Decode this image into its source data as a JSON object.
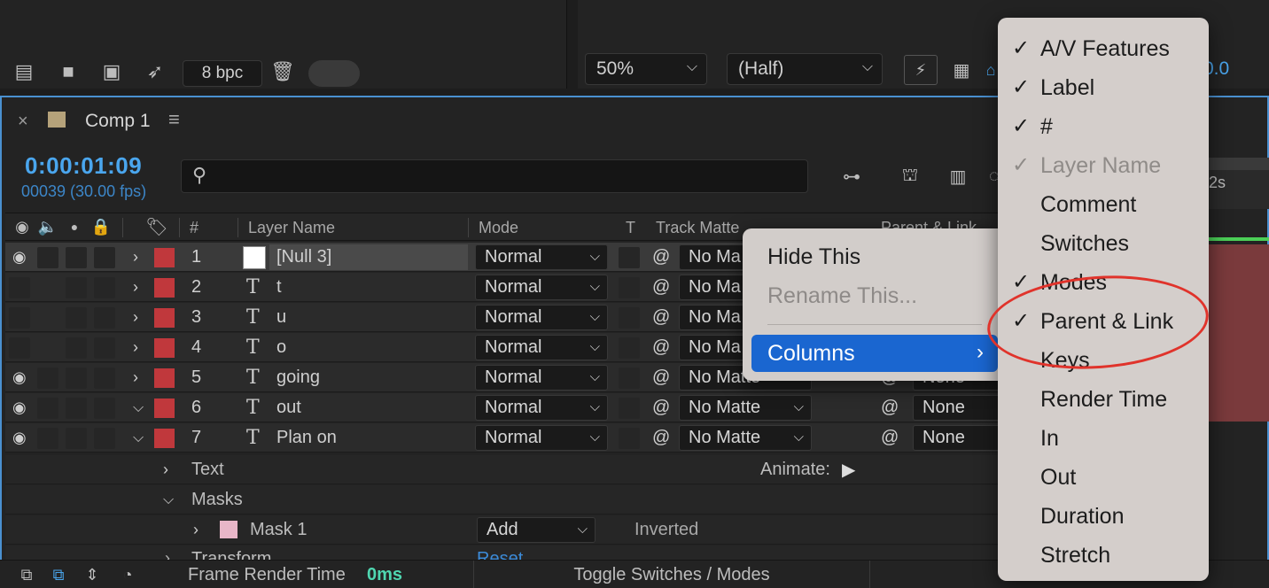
{
  "project_toolbar": {
    "bpc": "8 bpc"
  },
  "viewer_toolbar": {
    "zoom": "50%",
    "resolution": "(Half)",
    "exposure_value": "0.0"
  },
  "timeline": {
    "tab_title": "Comp 1",
    "timecode": "0:00:01:09",
    "frame_info": "00039 (30.00 fps)",
    "ruler_label": "2s",
    "columns": {
      "number": "#",
      "layer_name": "Layer Name",
      "mode": "Mode",
      "t": "T",
      "track_matte": "Track Matte",
      "parent_link": "Parent & Link"
    },
    "layers": [
      {
        "num": "1",
        "name": "[Null 3]",
        "mode": "Normal",
        "matte": "No Ma",
        "parent": "",
        "visible": true,
        "expanded": false
      },
      {
        "num": "2",
        "name": "t",
        "mode": "Normal",
        "matte": "No Ma",
        "parent": "",
        "visible": false,
        "expanded": false
      },
      {
        "num": "3",
        "name": "u",
        "mode": "Normal",
        "matte": "No Ma",
        "parent": "",
        "visible": false,
        "expanded": false
      },
      {
        "num": "4",
        "name": "o",
        "mode": "Normal",
        "matte": "No Ma",
        "parent": "",
        "visible": false,
        "expanded": false
      },
      {
        "num": "5",
        "name": "going",
        "mode": "Normal",
        "matte": "No Matte",
        "parent": "None",
        "visible": true,
        "expanded": false
      },
      {
        "num": "6",
        "name": "out",
        "mode": "Normal",
        "matte": "No Matte",
        "parent": "None",
        "visible": true,
        "expanded": true
      },
      {
        "num": "7",
        "name": "Plan on",
        "mode": "Normal",
        "matte": "No Matte",
        "parent": "None",
        "visible": true,
        "expanded": true
      }
    ],
    "sub_rows": {
      "text": "Text",
      "animate": "Animate:",
      "masks": "Masks",
      "mask1": "Mask 1",
      "mask_mode": "Add",
      "inverted": "Inverted",
      "transform": "Transform",
      "reset": "Reset"
    },
    "footer": {
      "frame_render_label": "Frame Render Time",
      "frame_render_value": "0ms",
      "toggle": "Toggle Switches / Modes"
    }
  },
  "context_menu": {
    "hide_this": "Hide This",
    "rename_this": "Rename This...",
    "columns": "Columns"
  },
  "columns_submenu": [
    {
      "label": "A/V Features",
      "checked": true,
      "disabled": false
    },
    {
      "label": "Label",
      "checked": true,
      "disabled": false
    },
    {
      "label": "#",
      "checked": true,
      "disabled": false
    },
    {
      "label": "Layer Name",
      "checked": true,
      "disabled": true
    },
    {
      "label": "Comment",
      "checked": false,
      "disabled": false
    },
    {
      "label": "Switches",
      "checked": false,
      "disabled": false
    },
    {
      "label": "Modes",
      "checked": true,
      "disabled": false
    },
    {
      "label": "Parent & Link",
      "checked": true,
      "disabled": false
    },
    {
      "label": "Keys",
      "checked": false,
      "disabled": false
    },
    {
      "label": "Render Time",
      "checked": false,
      "disabled": false
    },
    {
      "label": "In",
      "checked": false,
      "disabled": false
    },
    {
      "label": "Out",
      "checked": false,
      "disabled": false
    },
    {
      "label": "Duration",
      "checked": false,
      "disabled": false
    },
    {
      "label": "Stretch",
      "checked": false,
      "disabled": false
    }
  ],
  "colors": {
    "accent": "#1a66d0",
    "timecode": "#4aa6ee",
    "layer_label": "#c0383c",
    "annotation": "#e0332b",
    "render_time": "#4fd6b0"
  }
}
